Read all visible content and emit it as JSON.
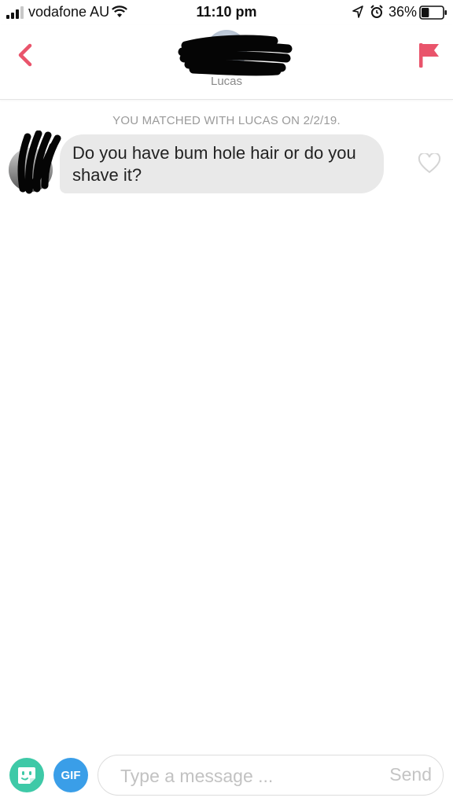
{
  "status_bar": {
    "carrier": "vodafone AU",
    "time": "11:10 pm",
    "battery_percent": "36%",
    "icons": [
      "signal-icon",
      "wifi-icon",
      "location-icon",
      "alarm-icon",
      "battery-icon"
    ],
    "signal_bars_filled": 3,
    "battery_level": 0.36
  },
  "header": {
    "match_name": "Lucas",
    "back_icon": "chevron-left-icon",
    "report_icon": "flag-icon"
  },
  "conversation": {
    "match_notice": "YOU MATCHED WITH LUCAS ON 2/2/19.",
    "messages": [
      {
        "text": "Do you have bum hole hair or do you shave it?",
        "liked": false
      }
    ]
  },
  "composer": {
    "sticker_icon": "sticker-icon",
    "gif_label": "GIF",
    "placeholder": "Type a message ...",
    "value": "",
    "send_label": "Send"
  },
  "colors": {
    "accent": "#e9546b",
    "sticker_button": "#3ec9a7",
    "gif_button": "#3a9ee8",
    "bubble": "#e9e9e9"
  }
}
